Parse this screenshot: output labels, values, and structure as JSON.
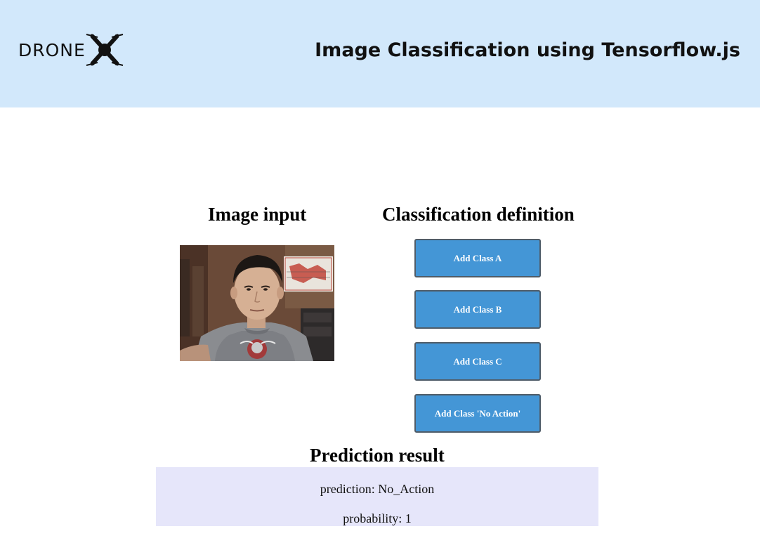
{
  "header": {
    "logo_text": "DRONE",
    "title": "Image Classification using Tensorflow.js",
    "background": "#d2e8fb"
  },
  "image_input": {
    "heading": "Image input",
    "camera_icon": "webcam-feed"
  },
  "classification": {
    "heading": "Classification definition",
    "buttons": [
      {
        "label": "Add Class A"
      },
      {
        "label": "Add Class B"
      },
      {
        "label": "Add Class C"
      },
      {
        "label": "Add Class 'No Action'"
      }
    ],
    "button_color": "#4496d6"
  },
  "prediction": {
    "heading": "Prediction result",
    "prediction_text": "prediction: No_Action",
    "probability_text": "probability: 1",
    "background": "#e6e6fa"
  }
}
